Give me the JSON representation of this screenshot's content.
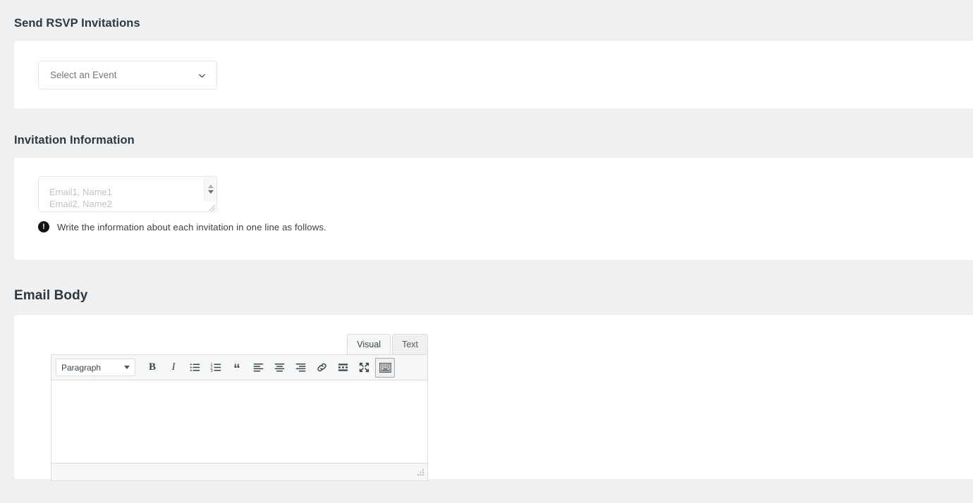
{
  "page": {
    "background": "#eff0f1",
    "card_background": "#ffffff",
    "heading_color": "#32373c"
  },
  "sections": {
    "event": {
      "heading": "Send RSVP Invitations",
      "select": {
        "value": "Select an Event",
        "icon": "chevron-down-icon"
      }
    },
    "invitation": {
      "heading": "Invitation Information",
      "textarea": {
        "value": "",
        "placeholder": "Email1, Name1\nEmail2, Name2",
        "spinner_up": "▲",
        "spinner_down": "▼"
      },
      "hint": {
        "icon_glyph": "!",
        "icon_name": "exclamation-circle-icon",
        "text": "Write the information about each invitation in one line as follows."
      }
    },
    "email_body": {
      "heading": "Email Body",
      "editor": {
        "tabs": [
          {
            "label": "Visual",
            "active": true
          },
          {
            "label": "Text",
            "active": false
          }
        ],
        "format_select": {
          "value": "Paragraph"
        },
        "toolbar_buttons": [
          {
            "name": "bold-icon",
            "label": "B",
            "title": "Bold"
          },
          {
            "name": "italic-icon",
            "label": "I",
            "title": "Italic"
          },
          {
            "name": "bulleted-list-icon",
            "label": "",
            "title": "Bulleted list"
          },
          {
            "name": "numbered-list-icon",
            "label": "",
            "title": "Numbered list"
          },
          {
            "name": "blockquote-icon",
            "label": "“",
            "title": "Blockquote"
          },
          {
            "name": "align-left-icon",
            "label": "",
            "title": "Align left"
          },
          {
            "name": "align-center-icon",
            "label": "",
            "title": "Align center"
          },
          {
            "name": "align-right-icon",
            "label": "",
            "title": "Align right"
          },
          {
            "name": "link-icon",
            "label": "",
            "title": "Insert/edit link"
          },
          {
            "name": "read-more-icon",
            "label": "",
            "title": "Insert Read More tag"
          },
          {
            "name": "fullscreen-icon",
            "label": "",
            "title": "Distraction-free writing mode"
          },
          {
            "name": "toolbar-toggle-icon",
            "label": "",
            "title": "Toolbar Toggle"
          }
        ],
        "content": ""
      }
    }
  }
}
